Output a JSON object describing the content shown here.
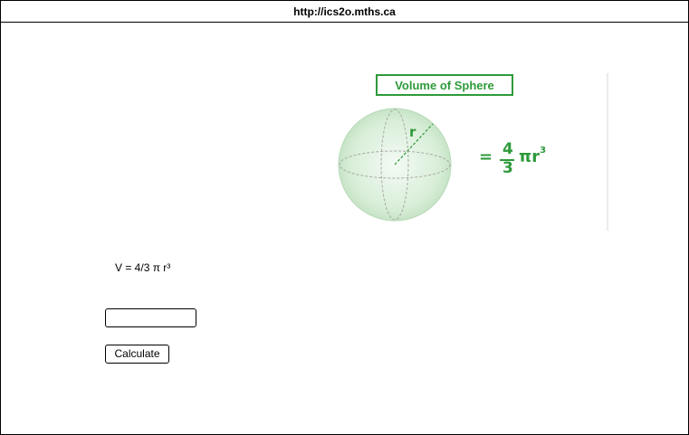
{
  "address_bar": {
    "url": "http://ics2o.mths.ca"
  },
  "figure": {
    "title": "Volume of Sphere",
    "radius_label": "r",
    "formula": {
      "equals": "=",
      "numerator": "4",
      "denominator": "3",
      "pi_r": "πr",
      "exponent": "3"
    },
    "color": "#2e9a3a"
  },
  "main": {
    "formula_text": "V = 4/3 π r³",
    "radius_input": {
      "value": "",
      "placeholder": ""
    },
    "calculate_button": "Calculate"
  }
}
